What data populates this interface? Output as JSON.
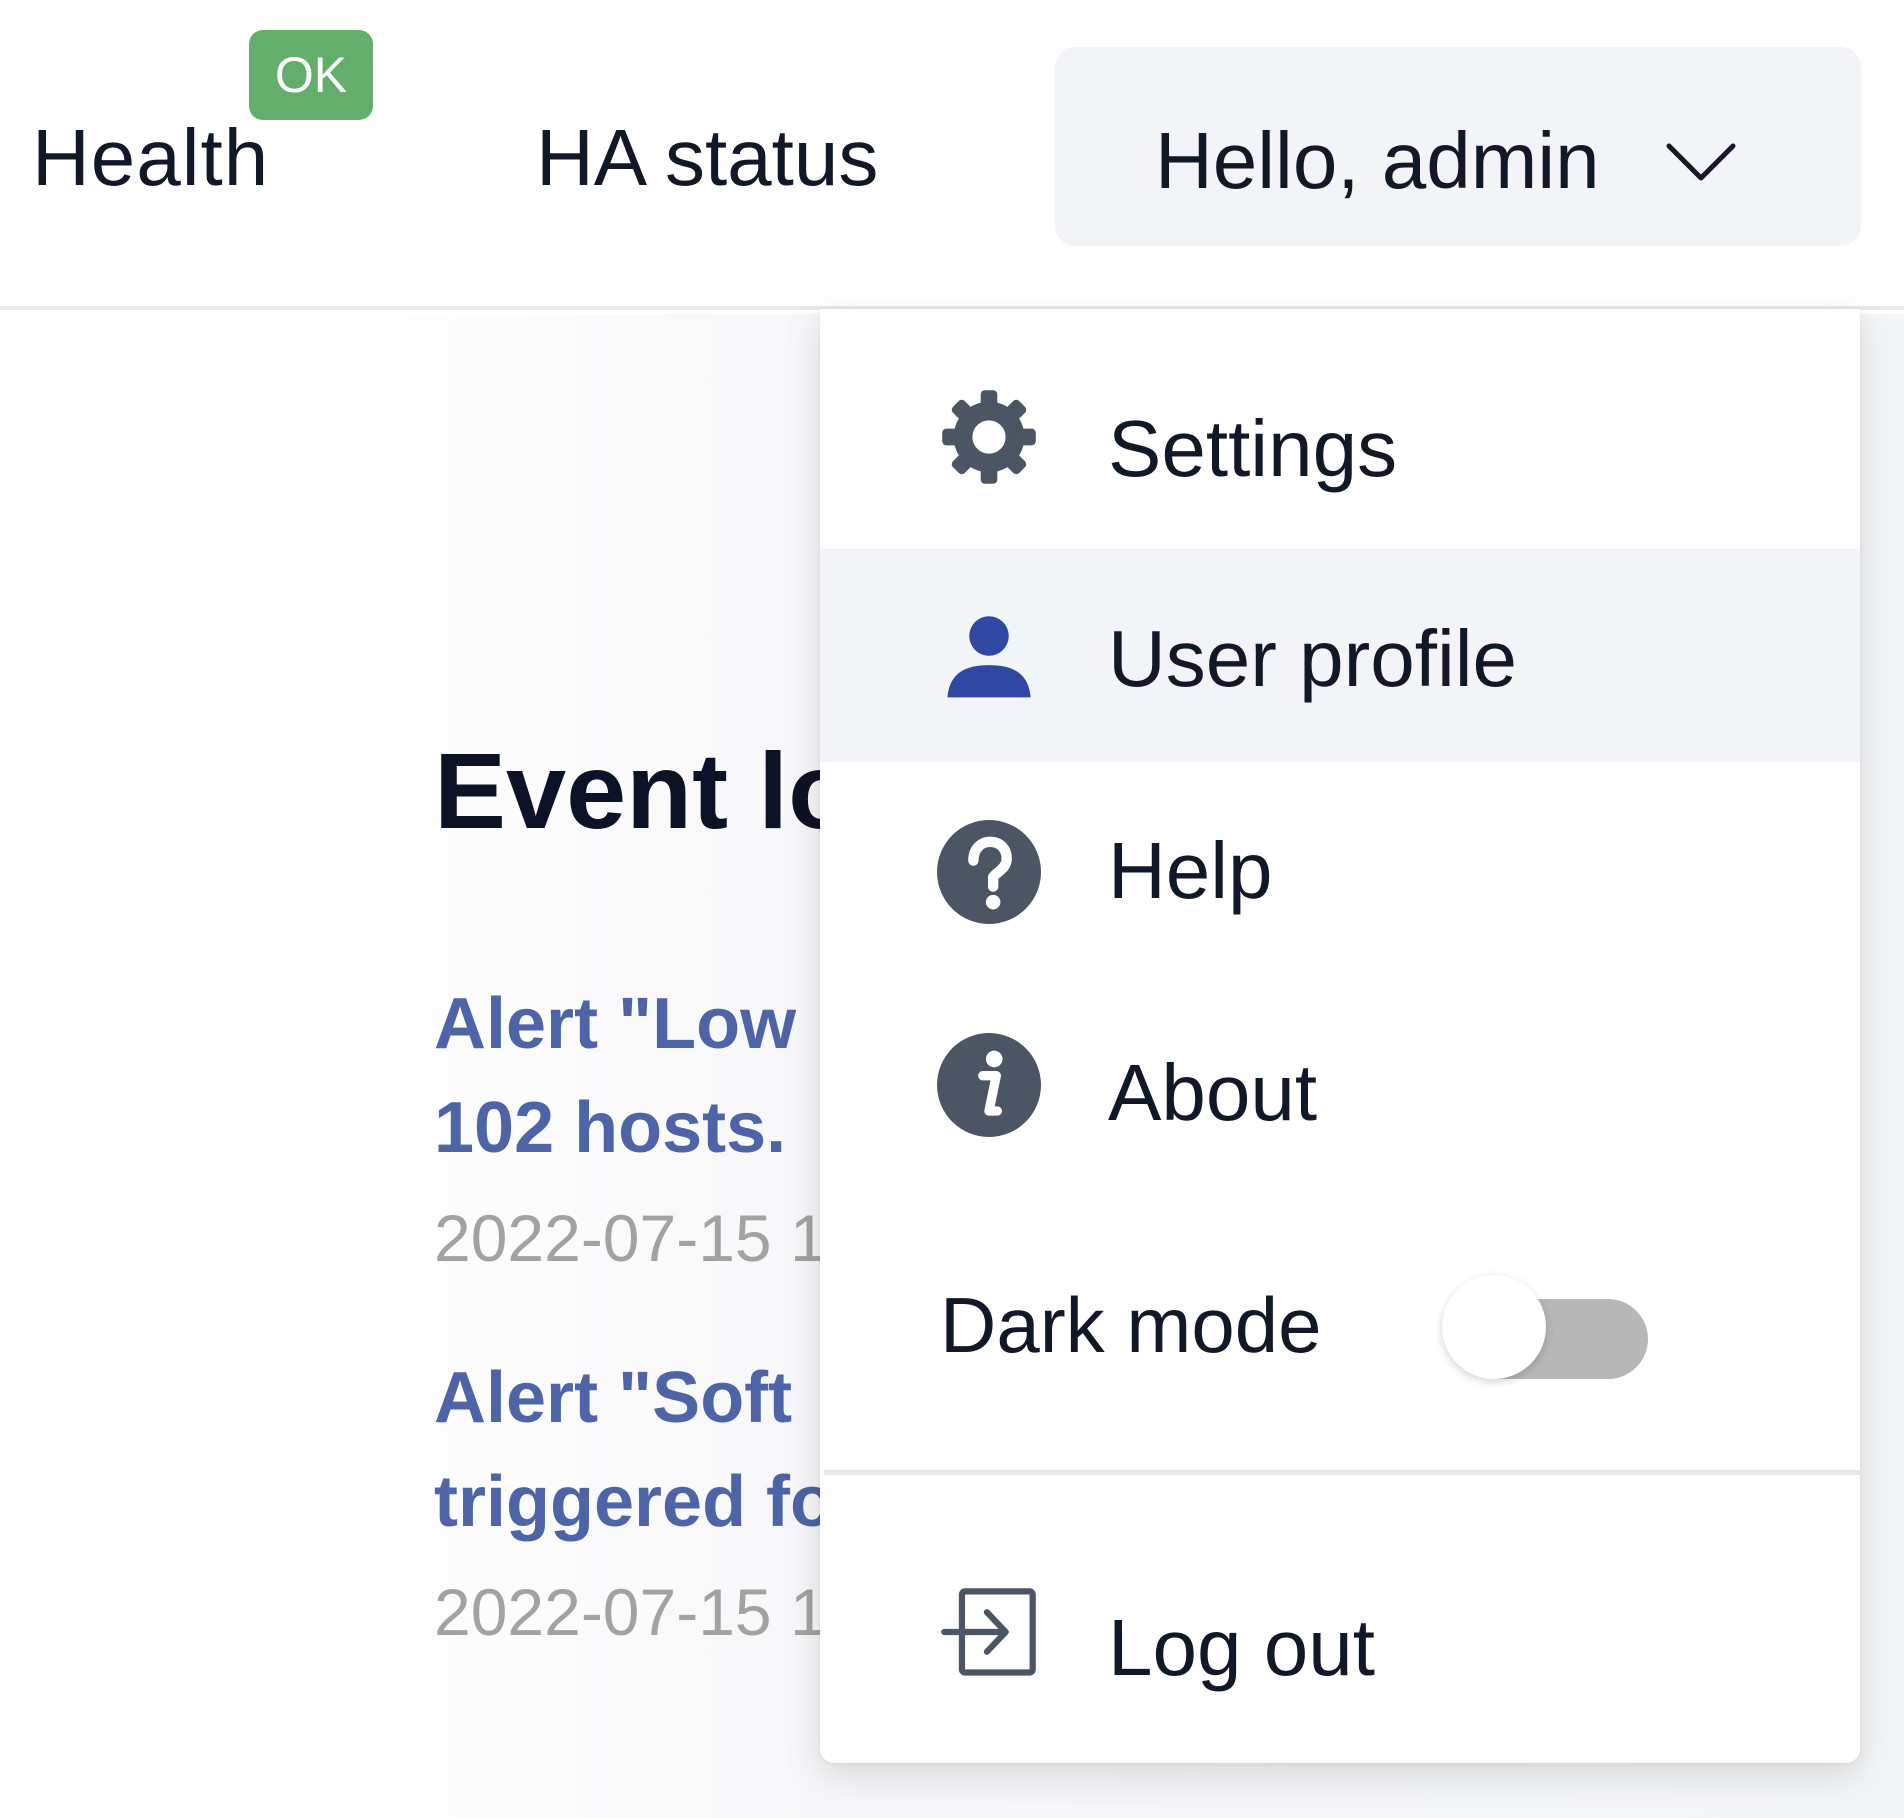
{
  "header": {
    "health_label": "Health",
    "health_badge": "OK",
    "ha_status_label": "HA status",
    "user_menu_label": "Hello, admin",
    "user_menu_icon": "chevron-down-icon",
    "badge_color": "#62ae6a"
  },
  "event_log": {
    "title": "Event lo",
    "items": [
      {
        "title_line1": "Alert \"Low",
        "title_line2": "102 hosts.",
        "timestamp": "2022-07-15 1"
      },
      {
        "title_line1": "Alert \"Soft",
        "title_line2": "triggered fo",
        "timestamp": "2022-07-15 1"
      }
    ],
    "link_color": "#4d64a6",
    "timestamp_color": "#a2a2a2"
  },
  "menu": {
    "items": [
      {
        "label": "Settings",
        "icon": "gear-icon",
        "active": false
      },
      {
        "label": "User profile",
        "icon": "user-icon",
        "active": true
      },
      {
        "label": "Help",
        "icon": "help-icon",
        "active": false
      },
      {
        "label": "About",
        "icon": "info-icon",
        "active": false
      }
    ],
    "dark_mode": {
      "label": "Dark mode",
      "enabled": false
    },
    "logout": {
      "label": "Log out",
      "icon": "logout-icon"
    },
    "active_background": "#f3f4f8",
    "accent_color": "#2f49a3"
  }
}
